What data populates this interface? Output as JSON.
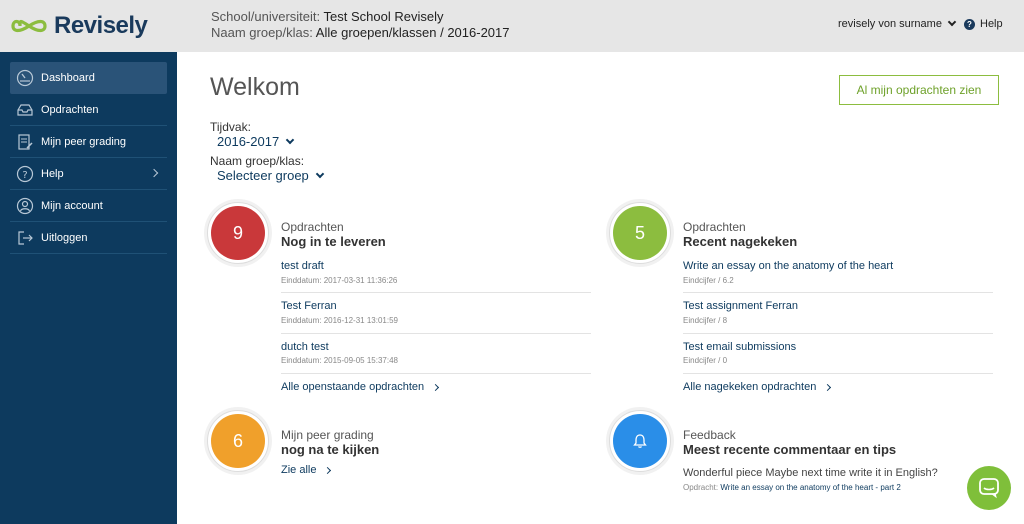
{
  "app": {
    "name": "Revisely"
  },
  "header": {
    "school_label": "School/universiteit:",
    "school_value": "Test School Revisely",
    "group_label": "Naam groep/klas:",
    "group_value": "Alle groepen/klassen / 2016-2017",
    "user_name": "revisely von surname",
    "help_label": "Help"
  },
  "sidebar": {
    "items": [
      {
        "label": "Dashboard",
        "icon": "gauge-icon",
        "active": true
      },
      {
        "label": "Opdrachten",
        "icon": "inbox-icon"
      },
      {
        "label": "Mijn peer grading",
        "icon": "document-edit-icon"
      },
      {
        "label": "Help",
        "icon": "question-icon"
      },
      {
        "label": "Mijn account",
        "icon": "user-icon"
      },
      {
        "label": "Uitloggen",
        "icon": "logout-icon"
      }
    ]
  },
  "main": {
    "title": "Welkom",
    "all_assignments_button": "Al mijn opdrachten zien",
    "tijdvak_label": "Tijdvak:",
    "tijdvak_value": "2016-2017",
    "group_label": "Naam groep/klas:",
    "group_value": "Selecteer groep"
  },
  "cards": {
    "pending": {
      "count": "9",
      "subtitle": "Opdrachten",
      "title": "Nog in te leveren",
      "items": [
        {
          "title": "test draft",
          "meta": "Einddatum: 2017-03-31 11:36:26"
        },
        {
          "title": "Test Ferran",
          "meta": "Einddatum: 2016-12-31 13:01:59"
        },
        {
          "title": "dutch test",
          "meta": "Einddatum: 2015-09-05 15:37:48"
        }
      ],
      "more": "Alle openstaande opdrachten"
    },
    "graded": {
      "count": "5",
      "subtitle": "Opdrachten",
      "title": "Recent nagekeken",
      "items": [
        {
          "title": "Write an essay on the anatomy of the heart",
          "meta": "Eindcijfer / 6.2"
        },
        {
          "title": "Test assignment Ferran",
          "meta": "Eindcijfer / 8"
        },
        {
          "title": "Test email submissions",
          "meta": "Eindcijfer / 0"
        }
      ],
      "more": "Alle nagekeken opdrachten"
    },
    "peer": {
      "count": "6",
      "subtitle": "Mijn peer grading",
      "title": "nog na te kijken",
      "more": "Zie alle"
    },
    "feedback": {
      "subtitle": "Feedback",
      "title": "Meest recente commentaar en tips",
      "text": "Wonderful piece Maybe next time write it in English?",
      "meta_label": "Opdracht:",
      "meta_link": "Write an essay on the anatomy of the heart - part 2"
    }
  },
  "colors": {
    "sidebar": "#0d3a5e",
    "red": "#c9383a",
    "green": "#8cbd3f",
    "orange": "#f0a02b",
    "blue": "#2a8ee8",
    "accent_green": "#7fbf3a"
  }
}
